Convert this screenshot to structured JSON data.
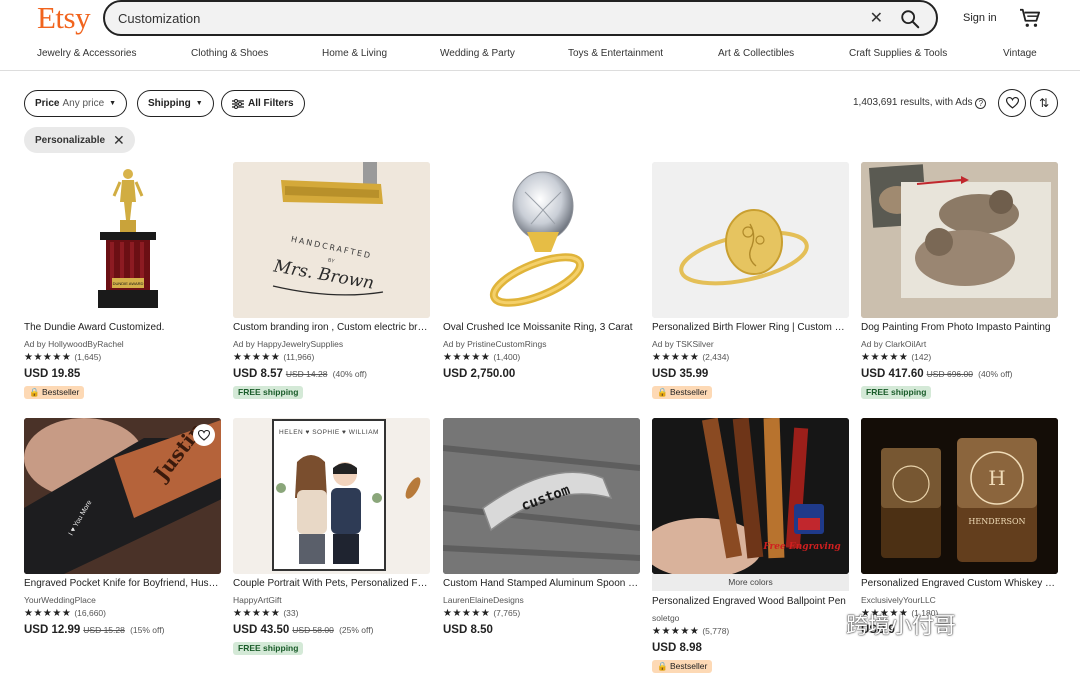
{
  "brand": {
    "logo": "Etsy",
    "color": "#F1641E"
  },
  "search": {
    "value": "Customization",
    "clear_icon": "close-icon",
    "submit_icon": "search-icon"
  },
  "header": {
    "signin": "Sign in",
    "cart_icon": "cart-icon"
  },
  "categories": [
    "Jewelry & Accessories",
    "Clothing & Shoes",
    "Home & Living",
    "Wedding & Party",
    "Toys & Entertainment",
    "Art & Collectibles",
    "Craft Supplies & Tools",
    "Vintage"
  ],
  "filters": {
    "price_label": "Price",
    "price_value": "Any price",
    "shipping_label": "Shipping",
    "all_filters": "All Filters",
    "results": "1,403,691 results, with Ads",
    "active_chip": "Personalizable"
  },
  "listings": [
    {
      "title": "The Dundie Award Customized.",
      "shop": "Ad by HollywoodByRachel",
      "stars": "★★★★★",
      "reviews": "(1,645)",
      "price": "USD 19.85",
      "orig": "",
      "off": "",
      "badge": "Bestseller",
      "badge_type": "best",
      "image": "trophy"
    },
    {
      "title": "Custom branding iron , Custom electric branding iron",
      "shop": "Ad by HappyJewelrySupplies",
      "stars": "★★★★★",
      "reviews": "(11,966)",
      "price": "USD 8.57",
      "orig": "USD 14.28",
      "off": "(40% off)",
      "badge": "FREE shipping",
      "badge_type": "free",
      "image": "branding"
    },
    {
      "title": "Oval Crushed Ice Moissanite Ring, 3 Carat",
      "shop": "Ad by PristineCustomRings",
      "stars": "★★★★★",
      "reviews": "(1,400)",
      "price": "USD 2,750.00",
      "orig": "",
      "off": "",
      "badge": "",
      "badge_type": "",
      "image": "ring"
    },
    {
      "title": "Personalized Birth Flower Ring | Custom Ring",
      "shop": "Ad by TSKSilver",
      "stars": "★★★★★",
      "reviews": "(2,434)",
      "price": "USD 35.99",
      "orig": "",
      "off": "",
      "badge": "Bestseller",
      "badge_type": "best",
      "image": "flower-ring"
    },
    {
      "title": "Dog Painting From Photo Impasto Painting",
      "shop": "Ad by ClarkOilArt",
      "stars": "★★★★★",
      "reviews": "(142)",
      "price": "USD 417.60",
      "orig": "USD 696.00",
      "off": "(40% off)",
      "badge": "FREE shipping",
      "badge_type": "free",
      "image": "dog"
    },
    {
      "title": "Engraved Pocket Knife for Boyfriend, Husband",
      "shop": "YourWeddingPlace",
      "stars": "★★★★★",
      "reviews": "(16,660)",
      "price": "USD 12.99",
      "orig": "USD 15.28",
      "off": "(15% off)",
      "badge": "",
      "badge_type": "",
      "image": "knife"
    },
    {
      "title": "Couple Portrait With Pets, Personalized Family Portrait",
      "shop": "HappyArtGift",
      "stars": "★★★★★",
      "reviews": "(33)",
      "price": "USD 43.50",
      "orig": "USD 58.00",
      "off": "(25% off)",
      "badge": "FREE shipping",
      "badge_type": "free",
      "image": "portrait"
    },
    {
      "title": "Custom Hand Stamped Aluminum Spoon Ring",
      "shop": "LaurenElaineDesigns",
      "stars": "★★★★★",
      "reviews": "(7,765)",
      "price": "USD 8.50",
      "orig": "",
      "off": "",
      "badge": "",
      "badge_type": "",
      "image": "cuff"
    },
    {
      "title": "Personalized Engraved Wood Ballpoint Pen",
      "shop": "soletgo",
      "stars": "★★★★★",
      "reviews": "(5,778)",
      "price": "USD 8.98",
      "orig": "",
      "off": "",
      "badge": "Bestseller",
      "badge_type": "best",
      "image": "pens",
      "more_colors": "More colors"
    },
    {
      "title": "Personalized Engraved Custom Whiskey Glasses",
      "shop": "ExclusivelyYourLLC",
      "stars": "★★★★★",
      "reviews": "(1,180)",
      "price": "USD 9",
      "orig": "",
      "off": "",
      "badge": "",
      "badge_type": "",
      "image": "glasses"
    }
  ],
  "pen_overlay": "Free Engraving",
  "cuff_text": "custom",
  "knife_text": "Justin",
  "knife_small": "I ♥ You More",
  "portrait_names": "HELEN ♥ SOPHIE ♥ WILLIAM",
  "branding_text": "HANDCRAFTED",
  "branding_by": "BY",
  "branding_name": "Mrs. Brown",
  "trophy_plate": "DUNDIE AWARD",
  "glass_text": "HENDERSON",
  "watermark": "跨境小付哥"
}
